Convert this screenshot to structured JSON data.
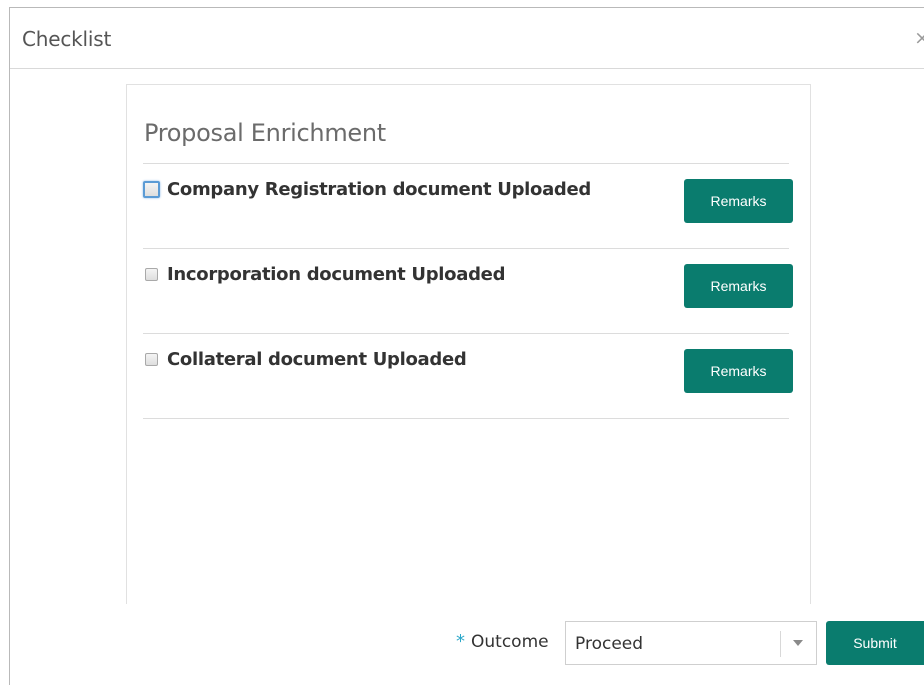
{
  "dialog": {
    "title": "Checklist",
    "close_glyph": "×"
  },
  "section": {
    "title": "Proposal Enrichment"
  },
  "items": [
    {
      "label": "Company Registration document Uploaded",
      "checked": false,
      "remarks_label": "Remarks"
    },
    {
      "label": "Incorporation document Uploaded",
      "checked": false,
      "remarks_label": "Remarks"
    },
    {
      "label": "Collateral document Uploaded",
      "checked": false,
      "remarks_label": "Remarks"
    }
  ],
  "footer": {
    "required_marker": "*",
    "outcome_label": "Outcome",
    "outcome_value": "Proceed",
    "submit_label": "Submit"
  },
  "colors": {
    "accent": "#0a7c6e",
    "required": "#2aa7c9"
  },
  "icons": {
    "close": "close-icon",
    "dropdown": "chevron-down-icon"
  }
}
